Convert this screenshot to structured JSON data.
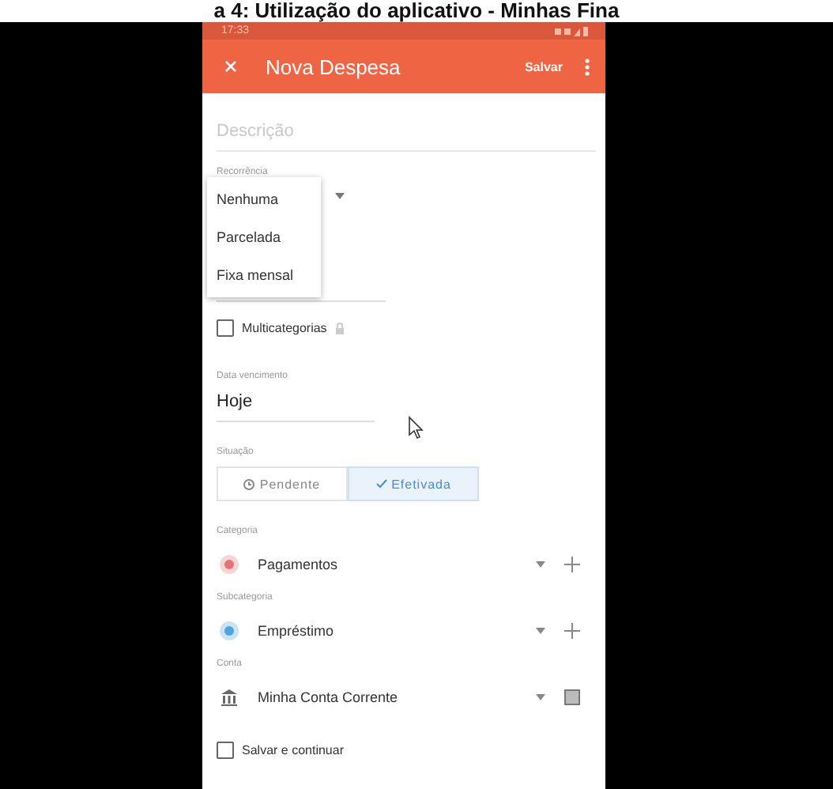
{
  "heading": "a 4: Utilização do aplicativo - Minhas Fina",
  "status_bar": {
    "time": "17:33"
  },
  "app_bar": {
    "title": "Nova Despesa",
    "action": "Salvar"
  },
  "description": {
    "placeholder": "Descrição"
  },
  "recurrence": {
    "label": "Recorrência",
    "options": [
      {
        "label": "Nenhuma",
        "selected": false
      },
      {
        "label": "Parcelada",
        "selected": false
      },
      {
        "label": "Fixa mensal",
        "selected": false
      }
    ]
  },
  "multicategory": {
    "label": "Multicategorias",
    "checked": false
  },
  "due_date": {
    "label": "Data vencimento",
    "value": "Hoje"
  },
  "status": {
    "label": "Situação",
    "options": [
      {
        "label": "Pendente",
        "selected": false
      },
      {
        "label": "Efetivada",
        "selected": true
      }
    ]
  },
  "pickers": [
    {
      "kind": "category",
      "label": "Categoria",
      "value": "Pagamentos",
      "color": "#e57373"
    },
    {
      "kind": "category",
      "label": "Subcategoria",
      "value": "Empréstimo",
      "color": "#4fa3e0"
    },
    {
      "kind": "account",
      "label": "Conta",
      "value": "Minha Conta Corrente"
    }
  ],
  "save_continue": {
    "label": "Salvar e continuar",
    "checked": false
  }
}
